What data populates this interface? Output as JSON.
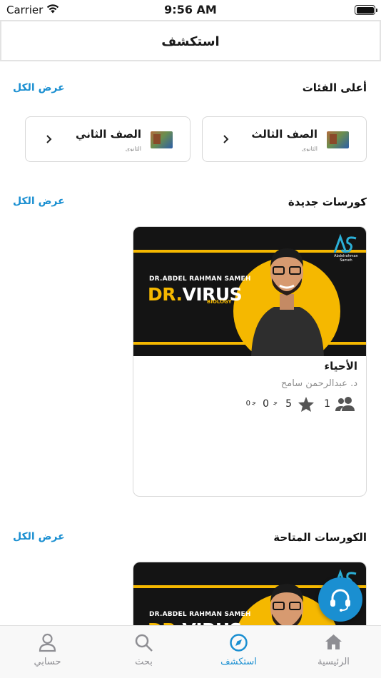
{
  "status_bar": {
    "carrier": "Carrier",
    "time": "9:56 AM"
  },
  "nav": {
    "title": "استكشف"
  },
  "top_categories": {
    "title": "أعلى الفئات",
    "see_all": "عرض الكل",
    "items": [
      {
        "name": "الصف الثالث",
        "subtitle": "الثانوي"
      },
      {
        "name": "الصف الثاني",
        "subtitle": "الثانوي"
      }
    ]
  },
  "new_courses": {
    "title": "كورسات جديدة",
    "see_all": "عرض الكل",
    "course": {
      "banner": {
        "subtitle": "DR.ABDEL RAHMAN SAMEH",
        "brand_prefix": "DR.",
        "brand_main": "VIRUS",
        "tag": "BIOLOGY",
        "logo_text": "Abdelrahman Sameh"
      },
      "title": "الأحياء",
      "teacher": "د. عبدالرحمن سامح",
      "students": "1",
      "rating": "5",
      "rating_extra": "0",
      "price": "0",
      "colors": {
        "accent": "#f5b800",
        "banner_bg": "#141414"
      }
    }
  },
  "available_courses": {
    "title": "الكورسات المتاحة",
    "see_all": "عرض الكل",
    "course": {
      "banner": {
        "subtitle": "DR.ABDEL RAHMAN SAMEH",
        "brand_prefix": "DR.",
        "brand_main": "VIRUS"
      }
    }
  },
  "tab_bar": {
    "tabs": [
      {
        "label": "الرئيسية",
        "icon": "home-icon"
      },
      {
        "label": "استكشف",
        "icon": "compass-icon",
        "active": true
      },
      {
        "label": "بحث",
        "icon": "search-icon"
      },
      {
        "label": "حسابي",
        "icon": "person-icon"
      }
    ]
  },
  "colors": {
    "primary": "#1a8fd1",
    "inactive": "#8e8e93"
  }
}
